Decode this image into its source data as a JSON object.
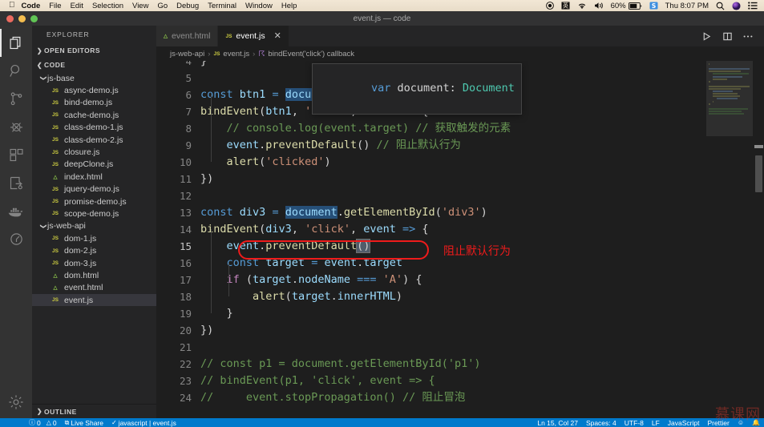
{
  "macos_menubar": {
    "apple_icon": "apple-icon",
    "items": [
      "Code",
      "File",
      "Edit",
      "Selection",
      "View",
      "Go",
      "Debug",
      "Terminal",
      "Window",
      "Help"
    ],
    "status_right": {
      "screen_record_icon": "record-circle-icon",
      "input_source_icon": "input-source-icon",
      "wifi_icon": "wifi-icon",
      "volume_icon": "volume-icon",
      "battery_percent": "60%",
      "battery_icon": "battery-icon",
      "sogou_icon": "sogou-s-icon",
      "clock": "Thu 8:07 PM",
      "search_icon": "search-icon",
      "siri_icon": "siri-icon",
      "control_center_icon": "control-center-icon"
    }
  },
  "titlebar": {
    "title": "event.js — code"
  },
  "activitybar": {
    "items": [
      {
        "name": "explorer",
        "icon": "files-icon",
        "active": true
      },
      {
        "name": "search",
        "icon": "search-icon",
        "active": false
      },
      {
        "name": "source-control",
        "icon": "source-control-icon",
        "active": false
      },
      {
        "name": "run-and-debug",
        "icon": "debug-bug-icon",
        "active": false
      },
      {
        "name": "extensions",
        "icon": "extensions-icon",
        "active": false
      },
      {
        "name": "live-share",
        "icon": "live-share-icon",
        "active": false
      },
      {
        "name": "docker",
        "icon": "docker-whale-icon",
        "active": false
      },
      {
        "name": "remote-explorer",
        "icon": "remote-clock-icon",
        "active": false
      }
    ],
    "bottom": {
      "name": "manage-settings",
      "icon": "gear-icon"
    }
  },
  "sidebar": {
    "title": "EXPLORER",
    "sections": [
      {
        "label": "OPEN EDITORS",
        "expanded": false
      },
      {
        "label": "CODE",
        "expanded": true
      }
    ],
    "outline_label": "OUTLINE",
    "tree": [
      {
        "kind": "folder",
        "label": "js-base",
        "depth": 1,
        "expanded": true
      },
      {
        "kind": "js",
        "label": "async-demo.js",
        "depth": 2
      },
      {
        "kind": "js",
        "label": "bind-demo.js",
        "depth": 2
      },
      {
        "kind": "js",
        "label": "cache-demo.js",
        "depth": 2
      },
      {
        "kind": "js",
        "label": "class-demo-1.js",
        "depth": 2
      },
      {
        "kind": "js",
        "label": "class-demo-2.js",
        "depth": 2
      },
      {
        "kind": "js",
        "label": "closure.js",
        "depth": 2
      },
      {
        "kind": "js",
        "label": "deepClone.js",
        "depth": 2
      },
      {
        "kind": "html",
        "label": "index.html",
        "depth": 2
      },
      {
        "kind": "js",
        "label": "jquery-demo.js",
        "depth": 2
      },
      {
        "kind": "js",
        "label": "promise-demo.js",
        "depth": 2
      },
      {
        "kind": "js",
        "label": "scope-demo.js",
        "depth": 2
      },
      {
        "kind": "folder",
        "label": "js-web-api",
        "depth": 1,
        "expanded": true
      },
      {
        "kind": "js",
        "label": "dom-1.js",
        "depth": 2
      },
      {
        "kind": "js",
        "label": "dom-2.js",
        "depth": 2
      },
      {
        "kind": "js",
        "label": "dom-3.js",
        "depth": 2
      },
      {
        "kind": "html",
        "label": "dom.html",
        "depth": 2
      },
      {
        "kind": "html",
        "label": "event.html",
        "depth": 2
      },
      {
        "kind": "js",
        "label": "event.js",
        "depth": 2,
        "selected": true
      }
    ]
  },
  "editor": {
    "tabs": [
      {
        "label": "event.html",
        "icon": "html-file-icon",
        "active": false,
        "dirty": false
      },
      {
        "label": "event.js",
        "icon": "js-file-icon",
        "active": true,
        "close_icon": "close-icon"
      }
    ],
    "actions": [
      {
        "name": "run-code",
        "icon": "play-icon"
      },
      {
        "name": "split-editor",
        "icon": "split-editor-icon"
      },
      {
        "name": "more-actions",
        "icon": "ellipsis-icon"
      }
    ],
    "breadcrumb": [
      "js-web-api",
      "event.js",
      "bindEvent('click') callback"
    ],
    "hover_tooltip": {
      "keyword": "var",
      "name": " document: ",
      "type": "Document"
    },
    "annotation": {
      "text": "阻止默认行为",
      "color": "#f01b1b",
      "target_line": 15
    },
    "lines": [
      {
        "n": 4,
        "text": "}"
      },
      {
        "n": 5,
        "text": ""
      },
      {
        "n": 6,
        "text": "const btn1 = document.getElementById('btn1')"
      },
      {
        "n": 7,
        "text": "bindEvent(btn1, 'click', event => {"
      },
      {
        "n": 8,
        "text": "    // console.log(event.target) // 获取触发的元素"
      },
      {
        "n": 9,
        "text": "    event.preventDefault() // 阻止默认行为"
      },
      {
        "n": 10,
        "text": "    alert('clicked')"
      },
      {
        "n": 11,
        "text": "})"
      },
      {
        "n": 12,
        "text": ""
      },
      {
        "n": 13,
        "text": "const div3 = document.getElementById('div3')"
      },
      {
        "n": 14,
        "text": "bindEvent(div3, 'click', event => {"
      },
      {
        "n": 15,
        "text": "    event.preventDefault()"
      },
      {
        "n": 16,
        "text": "    const target = event.target"
      },
      {
        "n": 17,
        "text": "    if (target.nodeName === 'A') {"
      },
      {
        "n": 18,
        "text": "        alert(target.innerHTML)"
      },
      {
        "n": 19,
        "text": "    }"
      },
      {
        "n": 20,
        "text": "})"
      },
      {
        "n": 21,
        "text": ""
      },
      {
        "n": 22,
        "text": "// const p1 = document.getElementById('p1')"
      },
      {
        "n": 23,
        "text": "// bindEvent(p1, 'click', event => {"
      },
      {
        "n": 24,
        "text": "//     event.stopPropagation() // 阻止冒泡"
      }
    ]
  },
  "statusbar": {
    "left": [
      {
        "name": "problems-errors",
        "icon": "error-circle-icon",
        "text": "0"
      },
      {
        "name": "problems-warnings",
        "icon": "warning-triangle-icon",
        "text": "0"
      },
      {
        "name": "live-share",
        "icon": "live-share-icon",
        "text": "Live Share"
      },
      {
        "name": "eslint-javascript",
        "icon": "check-icon",
        "text": "javascript | event.js"
      }
    ],
    "right": [
      {
        "name": "editor-position",
        "text": "Ln 15, Col 27"
      },
      {
        "name": "editor-indentation",
        "text": "Spaces: 4"
      },
      {
        "name": "editor-encoding",
        "text": "UTF-8"
      },
      {
        "name": "editor-eol",
        "text": "LF"
      },
      {
        "name": "editor-language",
        "text": "JavaScript"
      },
      {
        "name": "prettier-formatter",
        "text": "Prettier"
      },
      {
        "name": "smiley-feedback",
        "icon": "smiley-icon",
        "text": ""
      },
      {
        "name": "bell-notifications",
        "icon": "bell-icon",
        "text": ""
      }
    ]
  },
  "watermark": {
    "text": "慕课网"
  },
  "colors": {
    "accent": "#007acc",
    "editor_bg": "#1e1e1e",
    "sidebar_bg": "#252526",
    "activitybar_bg": "#333333",
    "annotation_red": "#f01b1b"
  }
}
